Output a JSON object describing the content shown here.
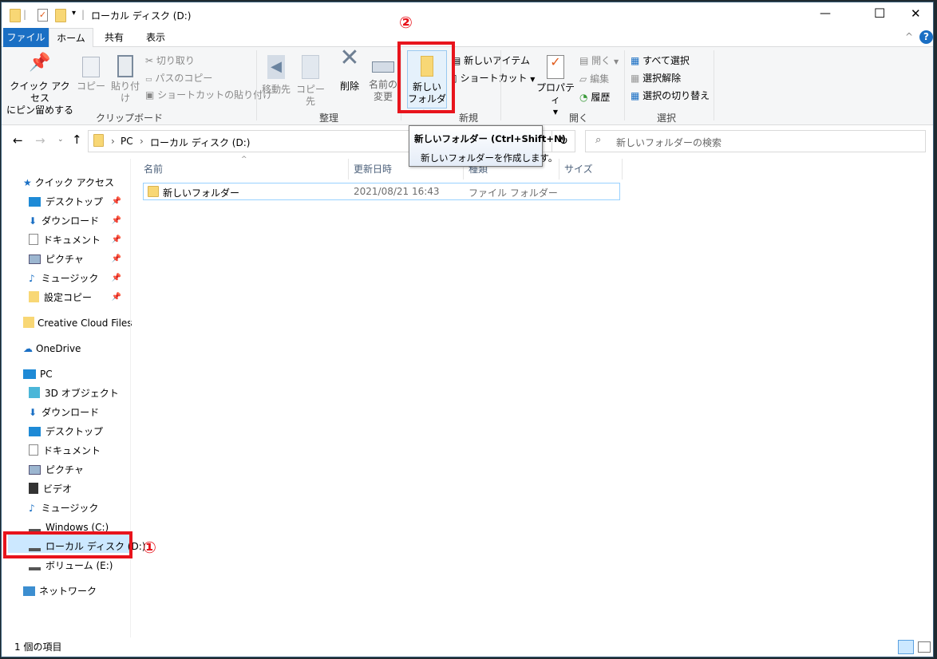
{
  "window": {
    "title": "ローカル ディスク (D:)",
    "minimize": "—",
    "maximize": "☐",
    "close": "✕",
    "help": "?",
    "collapse": "^"
  },
  "tabs": [
    "ファイル",
    "ホーム",
    "共有",
    "表示"
  ],
  "ribbon": {
    "clipboard": {
      "label": "クリップボード",
      "pin": "クイック アクセス\nにピン留めする",
      "pin1": "クイック アクセス",
      "pin2": "にピン留めする",
      "copy": "コピー",
      "paste": "貼り付け",
      "cut": "切り取り",
      "copy_path": "パスのコピー",
      "paste_shortcut": "ショートカットの貼り付け"
    },
    "organize": {
      "label": "整理",
      "move": "移動先",
      "copy_to": "コピー先",
      "delete": "削除",
      "rename1": "名前の",
      "rename2": "変更"
    },
    "new": {
      "label": "新規",
      "new_folder1": "新しい",
      "new_folder2": "フォルダー",
      "new_item": "新しいアイテム",
      "shortcut": "ショートカット"
    },
    "open": {
      "label": "開く",
      "properties": "プロパティ",
      "open": "開く",
      "edit": "編集",
      "history": "履歴"
    },
    "select": {
      "label": "選択",
      "all": "すべて選択",
      "none": "選択解除",
      "invert": "選択の切り替え"
    }
  },
  "tooltip": {
    "title": "新しいフォルダー (Ctrl+Shift+N)",
    "desc": "新しいフォルダーを作成します。"
  },
  "address": {
    "pc": "PC",
    "drive": "ローカル ディスク (D:)",
    "search_placeholder": "新しいフォルダーの検索"
  },
  "nav": {
    "quick_access": "クイック アクセス",
    "quick_items": [
      "デスクトップ",
      "ダウンロード",
      "ドキュメント",
      "ピクチャ",
      "ミュージック",
      "設定コピー"
    ],
    "creative_cloud": "Creative Cloud Files",
    "onedrive": "OneDrive",
    "pc": "PC",
    "pc_items": [
      "3D オブジェクト",
      "ダウンロード",
      "デスクトップ",
      "ドキュメント",
      "ピクチャ",
      "ビデオ",
      "ミュージック",
      "Windows (C:)",
      "ローカル ディスク (D:)",
      "ボリューム (E:)"
    ],
    "network": "ネットワーク"
  },
  "columns": [
    "名前",
    "更新日時",
    "種類",
    "サイズ"
  ],
  "files": [
    {
      "name": "新しいフォルダー",
      "modified": "2021/08/21 16:43",
      "type": "ファイル フォルダー",
      "size": ""
    }
  ],
  "status": {
    "count": "1 個の項目"
  },
  "annotations": {
    "one": "①",
    "two": "②"
  },
  "colors": {
    "accent": "#1a6fc4",
    "highlight": "#e8141c",
    "folder": "#f8d775",
    "selection": "#cce8ff"
  }
}
